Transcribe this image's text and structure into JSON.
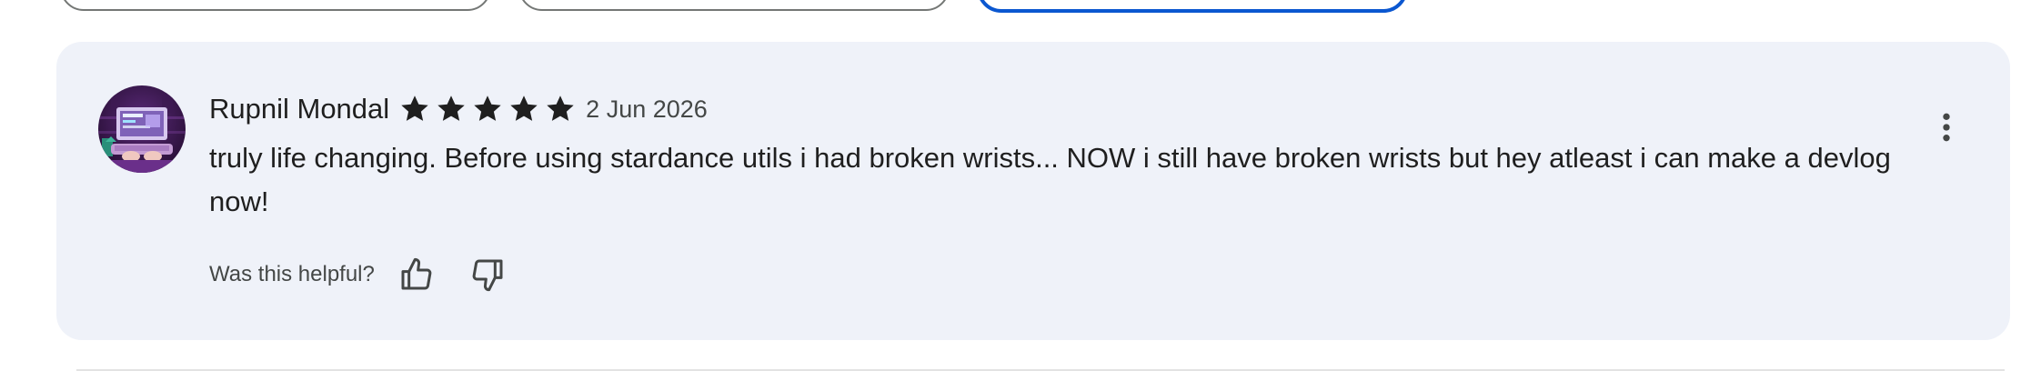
{
  "review": {
    "reviewer_name": "Rupnil Mondal",
    "rating": 5,
    "max_rating": 5,
    "date": "2 Jun 2026",
    "text": "truly life changing. Before using stardance utils i had broken wrists... NOW i still have broken wrists but hey atleast i can make a devlog now!",
    "helpful_prompt": "Was this helpful?"
  },
  "icons": {
    "avatar": "reviewer-avatar",
    "star": "star-icon",
    "thumbs_up": "thumbs-up-icon",
    "thumbs_down": "thumbs-down-icon",
    "more": "more-vert-icon"
  },
  "colors": {
    "card_background": "#eff2f9",
    "accent": "#0b57d0",
    "text_primary": "#1f1f1f",
    "text_secondary": "#444746"
  }
}
